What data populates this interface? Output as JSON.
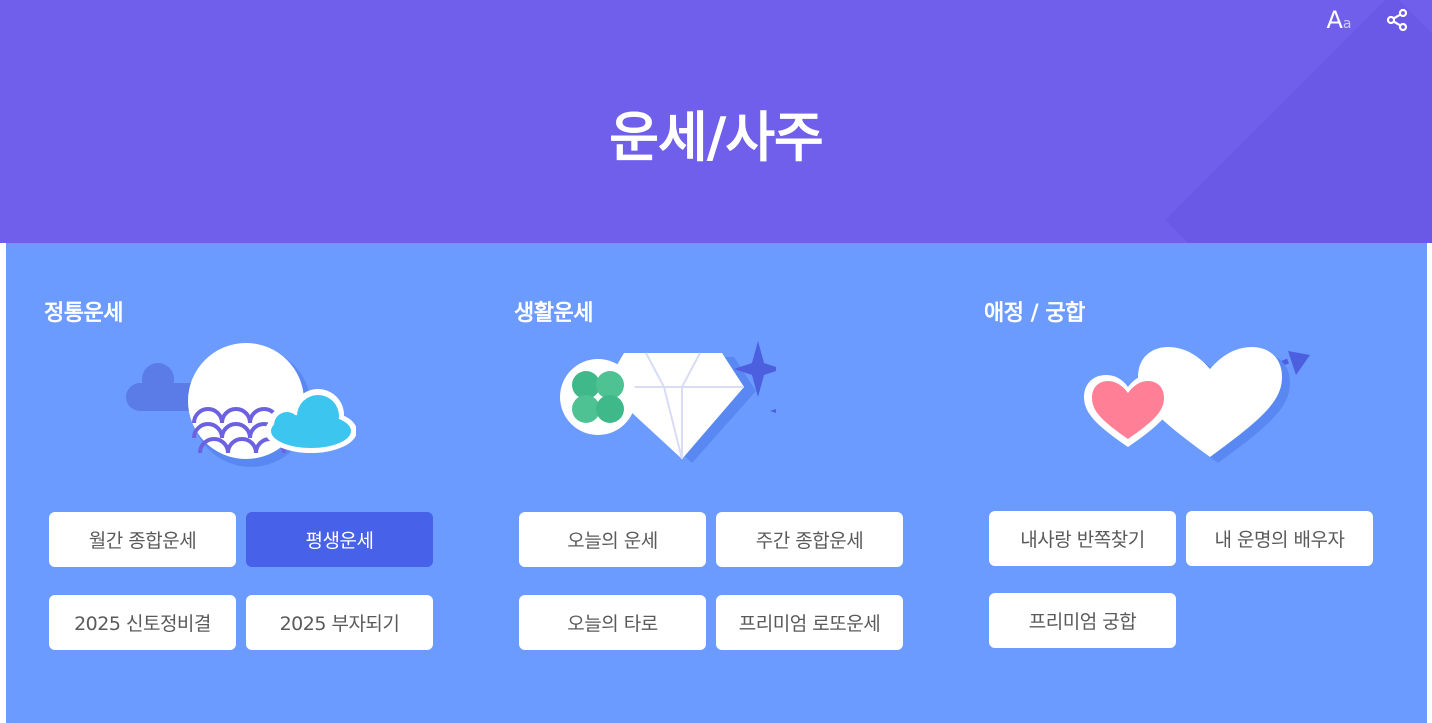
{
  "header": {
    "title": "운세/사주",
    "font_size_icon_big": "A",
    "font_size_icon_small": "a"
  },
  "sections": [
    {
      "title": "정통운세",
      "illustration": "moon-cloud-icon",
      "buttons": [
        {
          "label": "월간 종합운세",
          "active": false
        },
        {
          "label": "평생운세",
          "active": true
        },
        {
          "label": "2025 신토정비결",
          "active": false
        },
        {
          "label": "2025 부자되기",
          "active": false
        }
      ]
    },
    {
      "title": "생활운세",
      "illustration": "clover-diamond-icon",
      "buttons": [
        {
          "label": "오늘의 운세",
          "active": false
        },
        {
          "label": "주간 종합운세",
          "active": false
        },
        {
          "label": "오늘의 타로",
          "active": false
        },
        {
          "label": "프리미엄 로또운세",
          "active": false
        }
      ]
    },
    {
      "title": "애정 / 궁합",
      "illustration": "hearts-arrow-icon",
      "buttons": [
        {
          "label": "내사랑 반쪽찾기",
          "active": false
        },
        {
          "label": "내 운명의 배우자",
          "active": false
        },
        {
          "label": "프리미엄 궁합",
          "active": false
        }
      ]
    }
  ],
  "colors": {
    "header_bg": "#6f5fea",
    "main_bg": "#6b9bfe",
    "active_button": "#4761e8",
    "button_text": "#5a5a5a"
  }
}
